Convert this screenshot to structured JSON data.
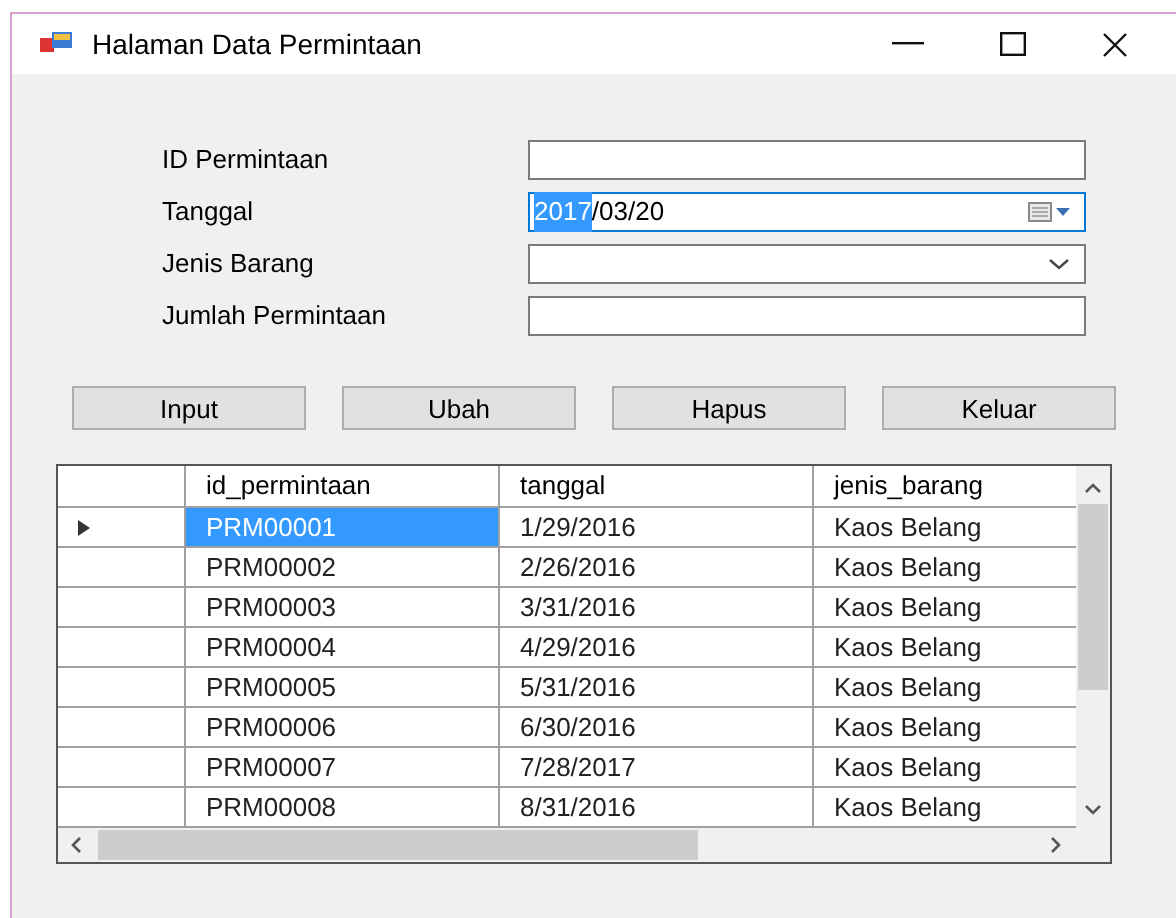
{
  "window": {
    "title": "Halaman Data Permintaan"
  },
  "form": [
    {
      "kind": "text",
      "label": "ID Permintaan"
    },
    {
      "kind": "date",
      "label": "Tanggal",
      "selected_part": "2017",
      "rest": "/03/20",
      "focused": true
    },
    {
      "kind": "combo",
      "label": "Jenis Barang"
    },
    {
      "kind": "text",
      "label": "Jumlah Permintaan"
    }
  ],
  "buttons": [
    "Input",
    "Ubah",
    "Hapus",
    "Keluar"
  ],
  "table": {
    "columns": [
      "id_permintaan",
      "tanggal",
      "jenis_barang"
    ],
    "rows": [
      {
        "cells": [
          "PRM00001",
          "1/29/2016",
          "Kaos Belang"
        ],
        "selected": true
      },
      {
        "cells": [
          "PRM00002",
          "2/26/2016",
          "Kaos Belang"
        ],
        "selected": false
      },
      {
        "cells": [
          "PRM00003",
          "3/31/2016",
          "Kaos Belang"
        ],
        "selected": false
      },
      {
        "cells": [
          "PRM00004",
          "4/29/2016",
          "Kaos Belang"
        ],
        "selected": false
      },
      {
        "cells": [
          "PRM00005",
          "5/31/2016",
          "Kaos Belang"
        ],
        "selected": false
      },
      {
        "cells": [
          "PRM00006",
          "6/30/2016",
          "Kaos Belang"
        ],
        "selected": false
      },
      {
        "cells": [
          "PRM00007",
          "7/28/2017",
          "Kaos Belang"
        ],
        "selected": false
      },
      {
        "cells": [
          "PRM00008",
          "8/31/2016",
          "Kaos Belang"
        ],
        "selected": false
      }
    ]
  }
}
